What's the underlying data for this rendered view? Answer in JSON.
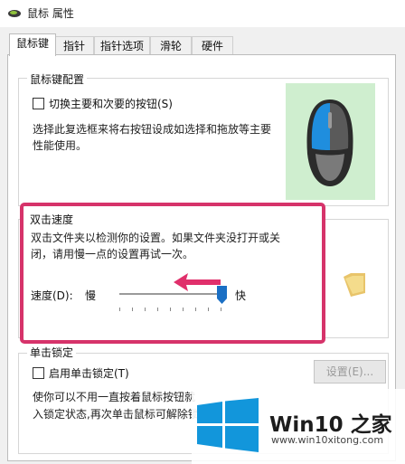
{
  "window": {
    "title": "鼠标 属性"
  },
  "tabs": [
    {
      "label": "鼠标键",
      "active": true
    },
    {
      "label": "指针",
      "active": false
    },
    {
      "label": "指针选项",
      "active": false
    },
    {
      "label": "滑轮",
      "active": false
    },
    {
      "label": "硬件",
      "active": false
    }
  ],
  "button_config": {
    "legend": "鼠标键配置",
    "checkbox_label": "切换主要和次要的按钮(S)",
    "checked": false,
    "desc_line1": "选择此复选框来将右按钮设成如选择和拖放等主要",
    "desc_line2": "性能使用。"
  },
  "double_click": {
    "legend": "双击速度",
    "desc_line1": "双击文件夹以检测你的设置。如果文件夹没打开或关",
    "desc_line2": "闭，请用慢一点的设置再试一次。",
    "speed_label": "速度(D):",
    "slow_label": "慢",
    "fast_label": "快",
    "slider_level": 0.97,
    "folder_icon": "folder-icon"
  },
  "click_lock": {
    "legend": "单击锁定",
    "checkbox_label": "启用单击锁定(T)",
    "checked": false,
    "settings_button": "设置(E)...",
    "desc_line1": "使你可以不用一直按着鼠标按钮就",
    "desc_line2": "入锁定状态,再次单击鼠标可解除锁"
  },
  "watermark": {
    "brand": "Win10 之家",
    "url": "www.win10xitong.com"
  },
  "colors": {
    "highlight": "#d6336a",
    "arrow": "#e02f6b",
    "mouse_bg": "#cfeecf",
    "windows_blue": "#1296db"
  }
}
